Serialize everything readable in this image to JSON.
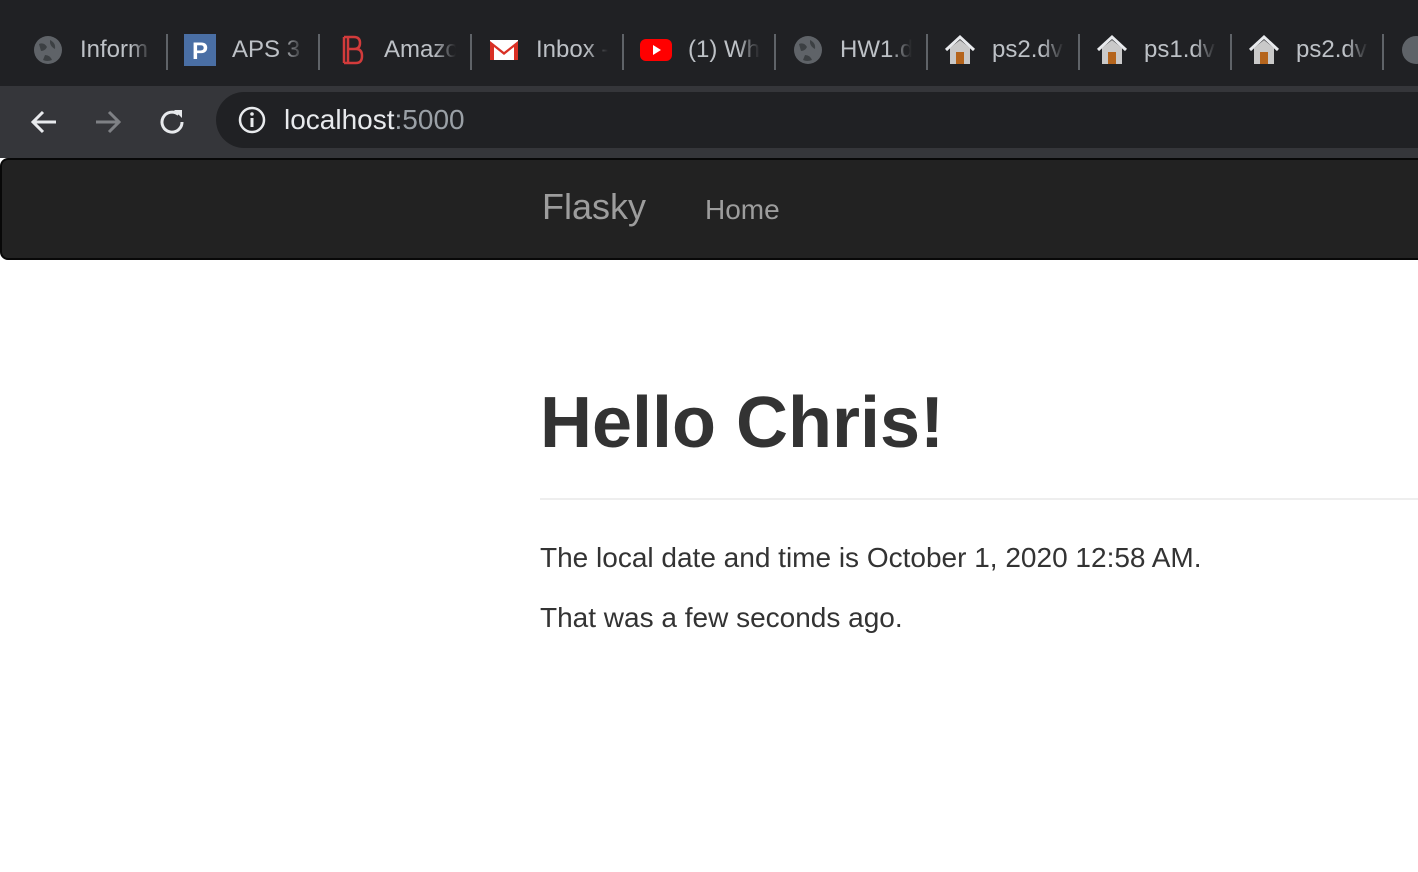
{
  "browser": {
    "tabs": [
      {
        "title": "Inform",
        "icon": "globe-icon"
      },
      {
        "title": "APS 3",
        "icon": "p-logo-icon"
      },
      {
        "title": "Amazo",
        "icon": "b-logo-icon"
      },
      {
        "title": "Inbox -",
        "icon": "gmail-icon"
      },
      {
        "title": "(1) Wh",
        "icon": "youtube-icon"
      },
      {
        "title": "HW1.d",
        "icon": "globe-icon"
      },
      {
        "title": "ps2.dv",
        "icon": "house-icon"
      },
      {
        "title": "ps1.dv",
        "icon": "house-icon"
      },
      {
        "title": "ps2.dv",
        "icon": "house-icon"
      }
    ],
    "url_host": "localhost",
    "url_port": ":5000"
  },
  "navbar": {
    "brand": "Flasky",
    "home": "Home"
  },
  "main": {
    "heading": "Hello Chris!",
    "datetime_text": "The local date and time is October 1, 2020 12:58 AM.",
    "relative_text": "That was a few seconds ago."
  },
  "colors": {
    "navbar_bg": "#222222",
    "navbar_text": "#9d9d9d",
    "body_text": "#333333",
    "chrome_dark": "#202124"
  }
}
